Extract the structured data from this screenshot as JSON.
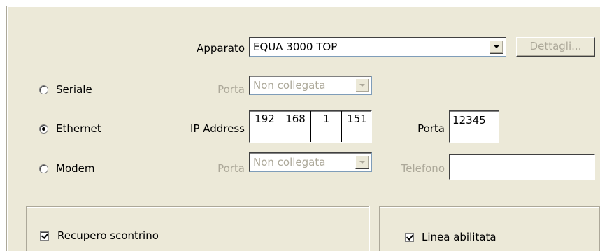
{
  "device": {
    "label": "Apparato",
    "selected": "EQUA 3000 TOP",
    "details_button": "Dettagli..."
  },
  "connection": {
    "serial": {
      "label": "Seriale",
      "selected": false,
      "port_label": "Porta",
      "port_value": "Non collegata"
    },
    "ethernet": {
      "label": "Ethernet",
      "selected": true,
      "ip_label": "IP Address",
      "ip_octets": [
        "192",
        "168",
        "1",
        "151"
      ],
      "port_label": "Porta",
      "port_value": "12345"
    },
    "modem": {
      "label": "Modem",
      "selected": false,
      "port_label": "Porta",
      "port_value": "Non collegata",
      "phone_label": "Telefono",
      "phone_value": ""
    }
  },
  "options": {
    "receipt_recovery": {
      "label": "Recupero scontrino",
      "checked": true
    },
    "line_enabled": {
      "label": "Linea abilitata",
      "checked": true
    }
  },
  "colors": {
    "face": "#ece9d8",
    "disabled_text": "#aca899",
    "border": "#7f9db9"
  }
}
